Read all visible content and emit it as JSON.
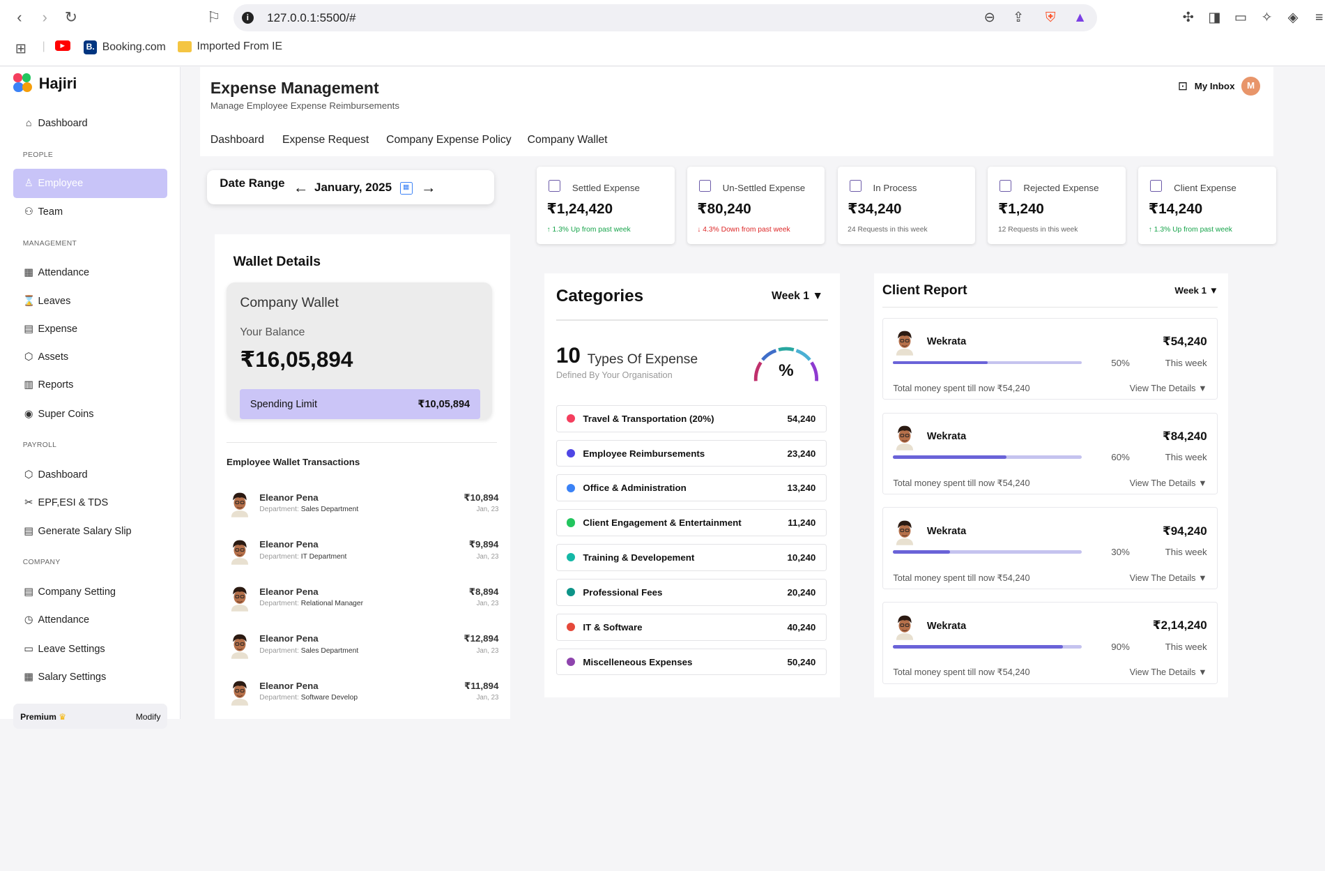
{
  "browser": {
    "url": "127.0.0.1:5500/#",
    "bookmarks": [
      "Booking.com",
      "Imported From IE"
    ]
  },
  "app": {
    "name": "Hajiri",
    "title": "Expense Management",
    "subtitle": "Manage Employee Expense Reimbursements",
    "inbox": "My Inbox",
    "avatar_initial": "M"
  },
  "sidebar": {
    "dashboard": "Dashboard",
    "people_head": "PEOPLE",
    "employee": "Employee",
    "team": "Team",
    "mgmt_head": "MANAGEMENT",
    "attendance": "Attendance",
    "leaves": "Leaves",
    "expense": "Expense",
    "assets": "Assets",
    "reports": "Reports",
    "supercoins": "Super Coins",
    "payroll_head": "PAYROLL",
    "pdashboard": "Dashboard",
    "epf": "EPF,ESI & TDS",
    "salaryslip": "Generate Salary Slip",
    "company_head": "COMPANY",
    "csetting": "Company Setting",
    "cattendance": "Attendance",
    "leavesettings": "Leave Settings",
    "salarysettings": "Salary Settings",
    "premium": "Premium",
    "modify": "Modify"
  },
  "tabs": [
    "Dashboard",
    "Expense Request",
    "Company Expense Policy",
    "Company Wallet"
  ],
  "daterange": {
    "label": "Date Range",
    "value": "January, 2025"
  },
  "stats": [
    {
      "title": "Settled Expense",
      "value": "₹1,24,420",
      "note": "↑ 1.3% Up from past week",
      "color": "#16a34a"
    },
    {
      "title": "Un-Settled Expense",
      "value": "₹80,240",
      "note": "↓ 4.3% Down from past week",
      "color": "#dc2626"
    },
    {
      "title": "In Process",
      "value": "₹34,240",
      "note": "24 Requests in this week",
      "color": "#666666"
    },
    {
      "title": "Rejected Expense",
      "value": "₹1,240",
      "note": "12 Requests in this week",
      "color": "#666666"
    },
    {
      "title": "Client Expense",
      "value": "₹14,240",
      "note": "↑ 1.3% Up from past week",
      "color": "#16a34a"
    }
  ],
  "wallet": {
    "heading": "Wallet Details",
    "box_title": "Company Wallet",
    "balance_label": "Your Balance",
    "balance": "₹16,05,894",
    "limit_label": "Spending Limit",
    "limit": "₹10,05,894",
    "tx_heading": "Employee Wallet Transactions",
    "dept_label": "Department:",
    "transactions": [
      {
        "name": "Eleanor Pena",
        "dept": "Sales Department",
        "amount": "₹10,894",
        "date": "Jan, 23"
      },
      {
        "name": "Eleanor Pena",
        "dept": "IT Department",
        "amount": "₹9,894",
        "date": "Jan, 23"
      },
      {
        "name": "Eleanor Pena",
        "dept": "Relational Manager",
        "amount": "₹8,894",
        "date": "Jan, 23"
      },
      {
        "name": "Eleanor Pena",
        "dept": "Sales Department",
        "amount": "₹12,894",
        "date": "Jan, 23"
      },
      {
        "name": "Eleanor Pena",
        "dept": "Software Develop",
        "amount": "₹11,894",
        "date": "Jan, 23"
      }
    ]
  },
  "categories": {
    "heading": "Categories",
    "week": "Week 1",
    "count": "10",
    "count_label": "Types Of Expense",
    "count_sub": "Defined By Your Organisation",
    "gauge_symbol": "%",
    "items": [
      {
        "label": "Travel & Transportation (20%)",
        "value": "54,240",
        "color": "#f43f5e"
      },
      {
        "label": "Employee Reimbursements",
        "value": "23,240",
        "color": "#4f46e5"
      },
      {
        "label": "Office & Administration",
        "value": "13,240",
        "color": "#3b82f6"
      },
      {
        "label": "Client Engagement & Entertainment",
        "value": "11,240",
        "color": "#22c55e"
      },
      {
        "label": "Training & Developement",
        "value": "10,240",
        "color": "#14b8a6"
      },
      {
        "label": "Professional Fees",
        "value": "20,240",
        "color": "#0d9488"
      },
      {
        "label": "IT & Software",
        "value": "40,240",
        "color": "#e5483a"
      },
      {
        "label": "Miscelleneous Expenses",
        "value": "50,240",
        "color": "#8e44ad"
      }
    ]
  },
  "client": {
    "heading": "Client Report",
    "week": "Week 1",
    "this_week": "This week",
    "view": "View The Details ▼",
    "rows": [
      {
        "name": "Wekrata",
        "amount": "₹54,240",
        "pct": "50%",
        "progress": 0.5,
        "total": "Total money spent till now ₹54,240"
      },
      {
        "name": "Wekrata",
        "amount": "₹84,240",
        "pct": "60%",
        "progress": 0.6,
        "total": "Total money spent till now ₹54,240"
      },
      {
        "name": "Wekrata",
        "amount": "₹94,240",
        "pct": "30%",
        "progress": 0.3,
        "total": "Total money spent till now ₹54,240"
      },
      {
        "name": "Wekrata",
        "amount": "₹2,14,240",
        "pct": "90%",
        "progress": 0.9,
        "total": "Total money spent till now ₹54,240"
      }
    ]
  }
}
